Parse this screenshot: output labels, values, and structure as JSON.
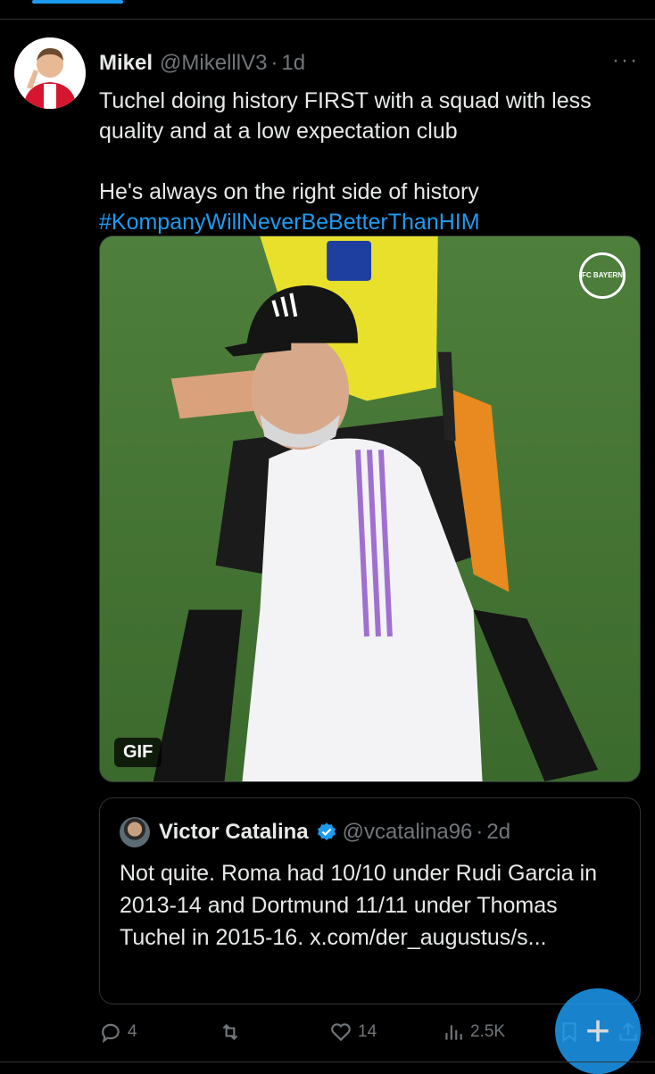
{
  "tweet": {
    "author": {
      "name": "Mikel",
      "handle": "@MikelllV3",
      "separator": "·",
      "time": "1d"
    },
    "more_label": "···",
    "text_line1": "Tuchel doing history FIRST with a squad with less quality and at a low expectation club",
    "text_line2": "He's always on the right side of history",
    "hashtag": "#KompanyWillNeverBeBetterThanHIM",
    "media": {
      "badge": "GIF",
      "watermark": "FC BAYERN MÜNCHEN"
    },
    "quote": {
      "name": "Victor Catalina",
      "handle": "@vcatalina96",
      "separator": "·",
      "time": "2d",
      "text": "Not quite. Roma had 10/10 under Rudi Garcia in 2013-14 and Dortmund 11/11 under Thomas Tuchel in 2015-16. x.com/der_augustus/s..."
    },
    "actions": {
      "replies": "4",
      "retweets": "",
      "likes": "14",
      "views": "2.5K"
    }
  },
  "fab_label": "+",
  "colors": {
    "accent": "#1d9bf0",
    "background": "#000000",
    "text": "#e7e9ea",
    "muted": "#71767b"
  }
}
